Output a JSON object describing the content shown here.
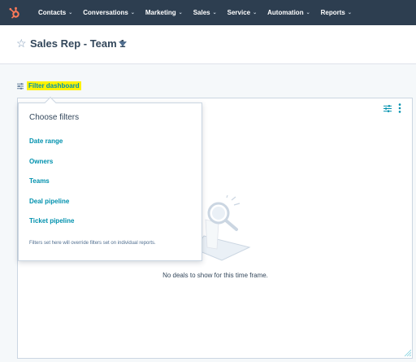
{
  "nav": {
    "items": [
      {
        "label": "Contacts"
      },
      {
        "label": "Conversations"
      },
      {
        "label": "Marketing"
      },
      {
        "label": "Sales"
      },
      {
        "label": "Service"
      },
      {
        "label": "Automation"
      },
      {
        "label": "Reports"
      }
    ]
  },
  "header": {
    "title": "Sales Rep - Team 1"
  },
  "filter": {
    "link_label": "Filter dashboard"
  },
  "popover": {
    "title": "Choose filters",
    "options": [
      {
        "label": "Date range"
      },
      {
        "label": "Owners"
      },
      {
        "label": "Teams"
      },
      {
        "label": "Deal pipeline"
      },
      {
        "label": "Ticket pipeline"
      }
    ],
    "note": "Filters set here will override filters set on individual reports."
  },
  "card": {
    "empty_message": "No deals to show for this time frame."
  },
  "colors": {
    "nav_bg": "#2d3e50",
    "brand_orange": "#ff7a59",
    "link_teal": "#0091ae",
    "highlight": "#fff200"
  }
}
